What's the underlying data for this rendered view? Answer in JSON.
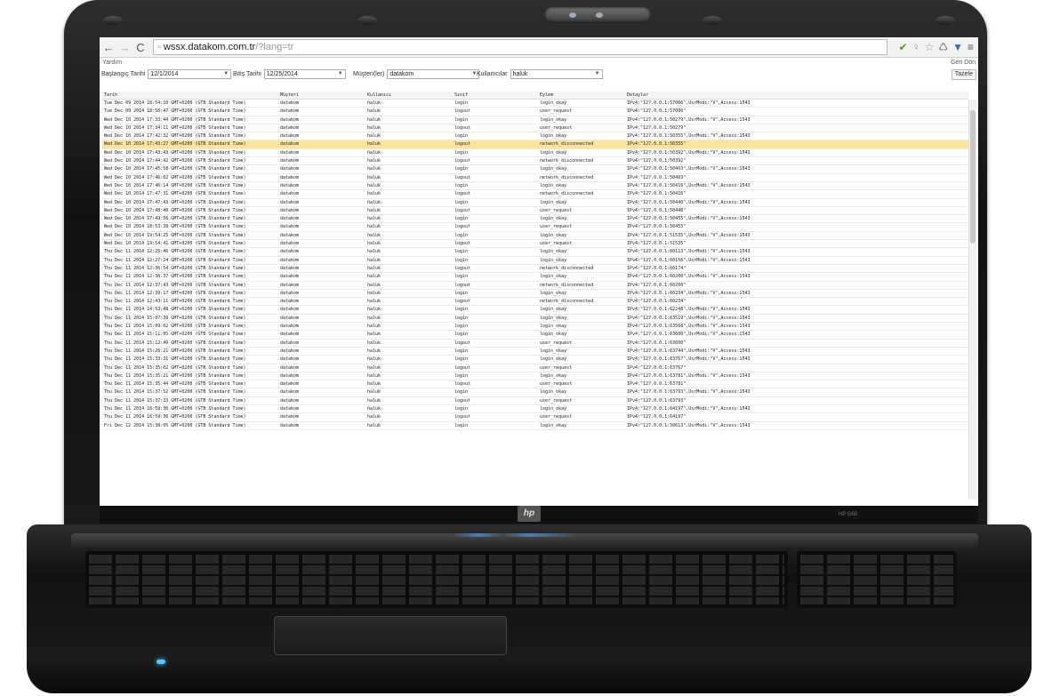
{
  "browser": {
    "url_host": "wssx.datakom.com.tr",
    "url_path": "/?lang=tr",
    "ext_icons": [
      "leaf-icon",
      "lightbulb-icon",
      "star-icon",
      "recycle-icon",
      "pin-icon",
      "menu-icon"
    ]
  },
  "menu": {
    "left": "Yardım",
    "right": "Geri Dön"
  },
  "filters": {
    "start_label": "Başlangıç Tarihi",
    "start_value": "12/1/2014",
    "end_label": "Bitiş Tarihi",
    "end_value": "12/25/2014",
    "customer_label": "Müşteri(ler)",
    "customer_value": "datakom",
    "users_label": "Kullanıcılar",
    "users_value": "haluk",
    "refresh_label": "Tazele"
  },
  "table": {
    "headers": [
      "Tarih",
      "Müşteri",
      "Kullanıcı",
      "Sınıf",
      "Eylem",
      "Detaylar"
    ],
    "selected_index": 5,
    "rows": [
      [
        "Tue Dec 09 2014 18:54:10 GMT+0200 (GTB Standard Time)",
        "datakom",
        "haluk",
        "login",
        "login_okay",
        "IPv4:\"127.0.0.1:57006\",UsrModi:\"V\",Access:1543"
      ],
      [
        "Tue Dec 09 2014 18:56:47 GMT+0200 (GTB Standard Time)",
        "datakom",
        "haluk",
        "logout",
        "user_request",
        "IPv4:\"127.0.0.1:57006\""
      ],
      [
        "Wed Dec 10 2014 17:33:44 GMT+0200 (GTB Standard Time)",
        "datakom",
        "haluk",
        "login",
        "login_okay",
        "IPv4:\"127.0.0.1:50279\",UsrModi:\"V\",Access:1543"
      ],
      [
        "Wed Dec 10 2014 17:34:11 GMT+0200 (GTB Standard Time)",
        "datakom",
        "haluk",
        "logout",
        "user_request",
        "IPv4:\"127.0.0.1:50279\""
      ],
      [
        "Wed Dec 10 2014 17:42:32 GMT+0200 (GTB Standard Time)",
        "datakom",
        "haluk",
        "login",
        "login_okay",
        "IPv4:\"127.0.0.1:50355\",UsrModi:\"V\",Access:1543"
      ],
      [
        "Wed Dec 10 2014 17:43:27 GMT+0200 (GTB Standard Time)",
        "datakom",
        "haluk",
        "logout",
        "network_disconnected",
        "IPv4:\"127.0.0.1:50355\""
      ],
      [
        "Wed Dec 10 2014 17:43:43 GMT+0200 (GTB Standard Time)",
        "datakom",
        "haluk",
        "login",
        "login_okay",
        "IPv4:\"127.0.0.1:50392\",UsrModi:\"V\",Access:1543"
      ],
      [
        "Wed Dec 10 2014 17:44:42 GMT+0200 (GTB Standard Time)",
        "datakom",
        "haluk",
        "logout",
        "network_disconnected",
        "IPv4:\"127.0.0.1:50392\""
      ],
      [
        "Wed Dec 10 2014 17:45:58 GMT+0200 (GTB Standard Time)",
        "datakom",
        "haluk",
        "login",
        "login_okay",
        "IPv4:\"127.0.0.1:50403\",UsrModi:\"V\",Access:1543"
      ],
      [
        "Wed Dec 10 2014 17:46:02 GMT+0200 (GTB Standard Time)",
        "datakom",
        "haluk",
        "logout",
        "network_disconnected",
        "IPv4:\"127.0.0.1:50403\""
      ],
      [
        "Wed Dec 10 2014 17:46:14 GMT+0200 (GTB Standard Time)",
        "datakom",
        "haluk",
        "login",
        "login_okay",
        "IPv4:\"127.0.0.1:50416\",UsrModi:\"V\",Access:1543"
      ],
      [
        "Wed Dec 10 2014 17:47:31 GMT+0200 (GTB Standard Time)",
        "datakom",
        "haluk",
        "logout",
        "network_disconnected",
        "IPv4:\"127.0.0.1:50416\""
      ],
      [
        "Wed Dec 10 2014 17:47:43 GMT+0200 (GTB Standard Time)",
        "datakom",
        "haluk",
        "login",
        "login_okay",
        "IPv4:\"127.0.0.1:50440\",UsrModi:\"V\",Access:1543"
      ],
      [
        "Wed Dec 10 2014 17:48:40 GMT+0200 (GTB Standard Time)",
        "datakom",
        "haluk",
        "logout",
        "user_request",
        "IPv4:\"127.0.0.1:50440\""
      ],
      [
        "Wed Dec 10 2014 17:49:56 GMT+0200 (GTB Standard Time)",
        "datakom",
        "haluk",
        "login",
        "login_okay",
        "IPv4:\"127.0.0.1:50455\",UsrModi:\"V\",Access:1543"
      ],
      [
        "Wed Dec 10 2014 18:53:38 GMT+0200 (GTB Standard Time)",
        "datakom",
        "haluk",
        "logout",
        "user_request",
        "IPv4:\"127.0.0.1:50455\""
      ],
      [
        "Wed Dec 10 2014 19:54:25 GMT+0200 (GTB Standard Time)",
        "datakom",
        "haluk",
        "login",
        "login_okay",
        "IPv4:\"127.0.0.1:51535\",UsrModi:\"V\",Access:1543"
      ],
      [
        "Wed Dec 10 2014 19:54:41 GMT+0200 (GTB Standard Time)",
        "datakom",
        "haluk",
        "logout",
        "user_request",
        "IPv4:\"127.0.0.1:51535\""
      ],
      [
        "Thu Dec 11 2014 12:25:46 GMT+0200 (GTB Standard Time)",
        "datakom",
        "haluk",
        "login",
        "login_okay",
        "IPv4:\"127.0.0.1:60113\",UsrModi:\"V\",Access:1543"
      ],
      [
        "Thu Dec 11 2014 12:27:24 GMT+0200 (GTB Standard Time)",
        "datakom",
        "haluk",
        "login",
        "login_okay",
        "IPv4:\"127.0.0.1:60156\",UsrModi:\"V\",Access:1543"
      ],
      [
        "Thu Dec 11 2014 12:36:54 GMT+0200 (GTB Standard Time)",
        "datakom",
        "haluk",
        "logout",
        "network_disconnected",
        "IPv4:\"127.0.0.1:60174\""
      ],
      [
        "Thu Dec 11 2014 12:36:37 GMT+0200 (GTB Standard Time)",
        "datakom",
        "haluk",
        "login",
        "login_okay",
        "IPv4:\"127.0.0.1:60200\",UsrModi:\"V\",Access:1543"
      ],
      [
        "Thu Dec 11 2014 12:37:43 GMT+0200 (GTB Standard Time)",
        "datakom",
        "haluk",
        "logout",
        "network_disconnected",
        "IPv4:\"127.0.0.1:60200\""
      ],
      [
        "Thu Dec 11 2014 12:39:17 GMT+0200 (GTB Standard Time)",
        "datakom",
        "haluk",
        "login",
        "login_okay",
        "IPv4:\"127.0.0.1:60234\",UsrModi:\"V\",Access:1543"
      ],
      [
        "Thu Dec 11 2014 12:43:11 GMT+0200 (GTB Standard Time)",
        "datakom",
        "haluk",
        "logout",
        "network_disconnected",
        "IPv4:\"127.0.0.1:60234\""
      ],
      [
        "Thu Dec 11 2014 14:53:48 GMT+0200 (GTB Standard Time)",
        "datakom",
        "haluk",
        "login",
        "login_okay",
        "IPv4:\"127.0.0.1:62248\",UsrModi:\"V\",Access:1543"
      ],
      [
        "Thu Dec 11 2014 15:07:39 GMT+0200 (GTB Standard Time)",
        "datakom",
        "haluk",
        "login",
        "login_okay",
        "IPv4:\"127.0.0.1:63519\",UsrModi:\"V\",Access:1543"
      ],
      [
        "Thu Dec 11 2014 15:09:02 GMT+0200 (GTB Standard Time)",
        "datakom",
        "haluk",
        "login",
        "login_okay",
        "IPv4:\"127.0.0.1:63568\",UsrModi:\"V\",Access:1543"
      ],
      [
        "Thu Dec 11 2014 15:11:05 GMT+0200 (GTB Standard Time)",
        "datakom",
        "haluk",
        "login",
        "login_okay",
        "IPv4:\"127.0.0.1:63600\",UsrModi:\"V\",Access:1543"
      ],
      [
        "Thu Dec 11 2014 15:12:49 GMT+0200 (GTB Standard Time)",
        "datakom",
        "haluk",
        "logout",
        "user_request",
        "IPv4:\"127.0.0.1:63600\""
      ],
      [
        "Thu Dec 11 2014 15:26:21 GMT+0200 (GTB Standard Time)",
        "datakom",
        "haluk",
        "login",
        "login_okay",
        "IPv4:\"127.0.0.1:63744\",UsrModi:\"V\",Access:1543"
      ],
      [
        "Thu Dec 11 2014 15:33:31 GMT+0200 (GTB Standard Time)",
        "datakom",
        "haluk",
        "login",
        "login_okay",
        "IPv4:\"127.0.0.1:63767\",UsrModi:\"V\",Access:1543"
      ],
      [
        "Thu Dec 11 2014 15:35:02 GMT+0200 (GTB Standard Time)",
        "datakom",
        "haluk",
        "logout",
        "user_request",
        "IPv4:\"127.0.0.1:63767\""
      ],
      [
        "Thu Dec 11 2014 15:35:21 GMT+0200 (GTB Standard Time)",
        "datakom",
        "haluk",
        "login",
        "login_okay",
        "IPv4:\"127.0.0.1:63781\",UsrModi:\"V\",Access:1543"
      ],
      [
        "Thu Dec 11 2014 15:35:44 GMT+0200 (GTB Standard Time)",
        "datakom",
        "haluk",
        "logout",
        "user_request",
        "IPv4:\"127.0.0.1:63781\""
      ],
      [
        "Thu Dec 11 2014 15:37:52 GMT+0200 (GTB Standard Time)",
        "datakom",
        "haluk",
        "login",
        "login_okay",
        "IPv4:\"127.0.0.1:63793\",UsrModi:\"V\",Access:1543"
      ],
      [
        "Thu Dec 11 2014 15:37:33 GMT+0200 (GTB Standard Time)",
        "datakom",
        "haluk",
        "logout",
        "user_request",
        "IPv4:\"127.0.0.1:63793\""
      ],
      [
        "Thu Dec 11 2014 16:59:36 GMT+0200 (GTB Standard Time)",
        "datakom",
        "haluk",
        "login",
        "login_okay",
        "IPv4:\"127.0.0.1:64197\",UsrModi:\"V\",Access:1543"
      ],
      [
        "Thu Dec 11 2014 16:59:36 GMT+0200 (GTB Standard Time)",
        "datakom",
        "haluk",
        "logout",
        "user_request",
        "IPv4:\"127.0.0.1:64197\""
      ],
      [
        "Fri Dec 12 2014 15:38:05 GMT+0200 (GTB Standard Time)",
        "datakom",
        "haluk",
        "login",
        "login_okay",
        "IPv4:\"127.0.0.1:50613\",UsrModi:\"V\",Access:1543"
      ]
    ]
  },
  "device": {
    "logo": "hp",
    "model": "HP G60"
  }
}
